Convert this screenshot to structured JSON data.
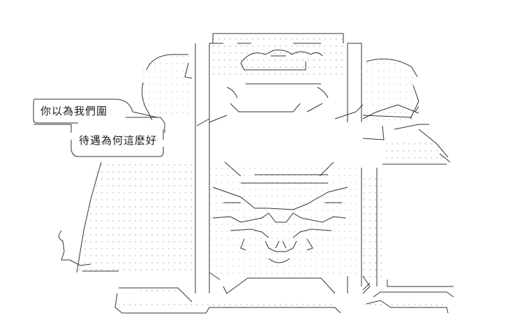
{
  "speech": {
    "line1": "你以為我們圍",
    "line2": "待遇為何這麽好"
  },
  "colors": {
    "ink": "#333333",
    "dots": "#9a9a9a",
    "background": "#ffffff"
  }
}
